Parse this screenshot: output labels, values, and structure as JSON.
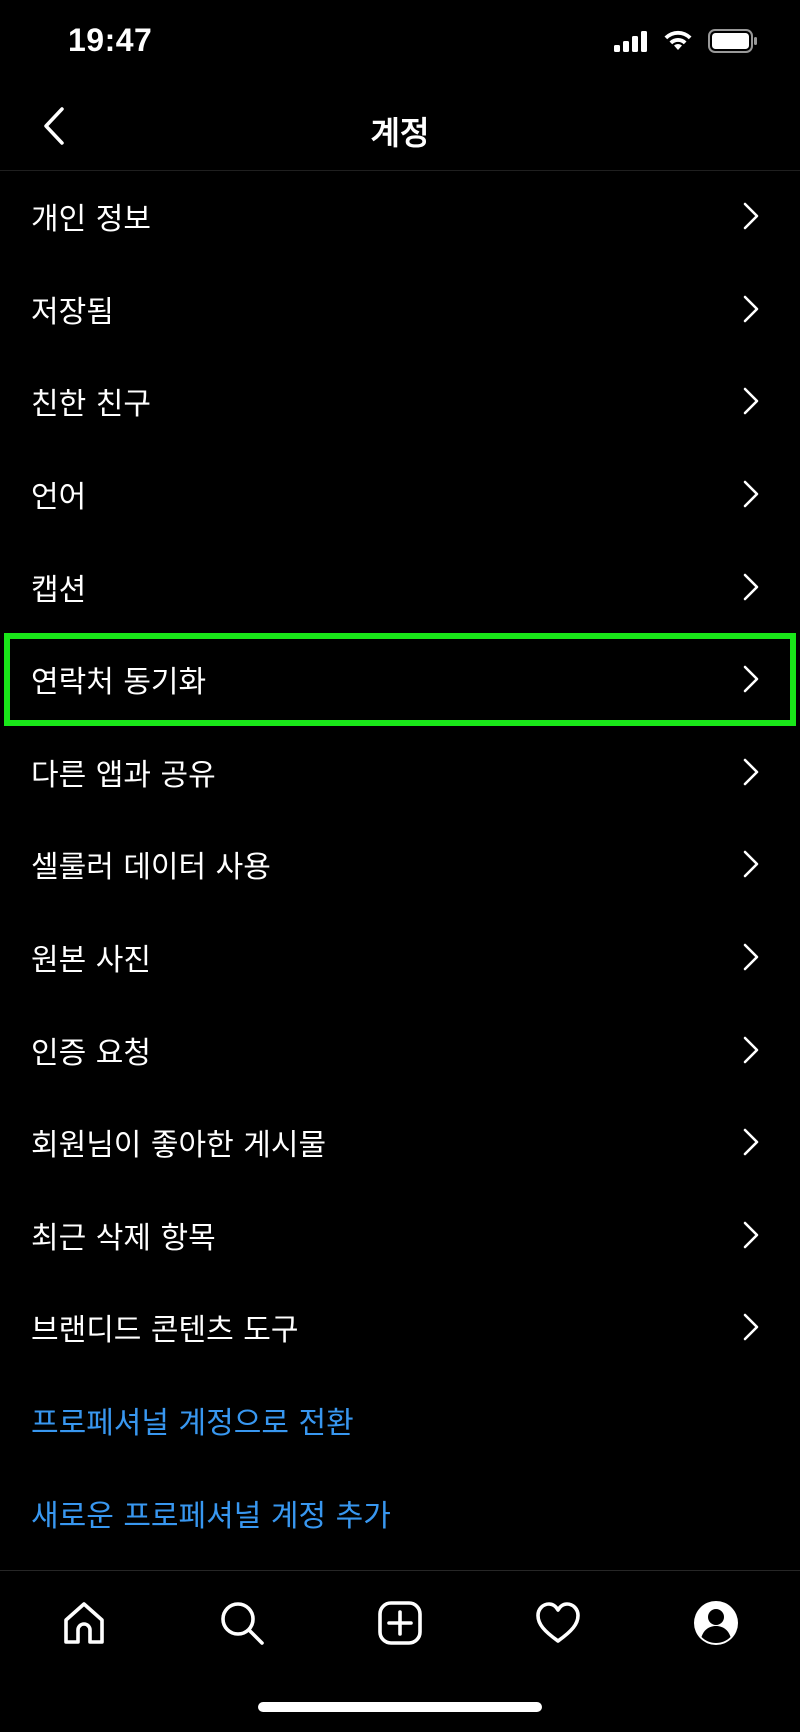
{
  "status_bar": {
    "time": "19:47",
    "icons": [
      "cellular-signal-icon",
      "wifi-icon",
      "battery-icon"
    ]
  },
  "header": {
    "title": "계정",
    "back_icon": "chevron-left-icon"
  },
  "settings": {
    "items": [
      {
        "label": "개인 정보"
      },
      {
        "label": "저장됨"
      },
      {
        "label": "친한 친구"
      },
      {
        "label": "언어"
      },
      {
        "label": "캡션"
      },
      {
        "label": "연락처 동기화",
        "highlighted": true
      },
      {
        "label": "다른 앱과 공유"
      },
      {
        "label": "셀룰러 데이터 사용"
      },
      {
        "label": "원본 사진"
      },
      {
        "label": "인증 요청"
      },
      {
        "label": "회원님이 좋아한 게시물"
      },
      {
        "label": "최근 삭제 항목"
      },
      {
        "label": "브랜디드 콘텐츠 도구"
      }
    ],
    "links": [
      {
        "label": "프로페셔널 계정으로 전환"
      },
      {
        "label": "새로운 프로페셔널 계정 추가"
      }
    ]
  },
  "tab_bar": {
    "tabs": [
      {
        "icon": "home-icon"
      },
      {
        "icon": "search-icon"
      },
      {
        "icon": "new-post-icon"
      },
      {
        "icon": "heart-icon"
      },
      {
        "icon": "profile-icon"
      }
    ]
  },
  "colors": {
    "background": "#000000",
    "text": "#ffffff",
    "link": "#3897f0",
    "highlight": "#19e619"
  }
}
